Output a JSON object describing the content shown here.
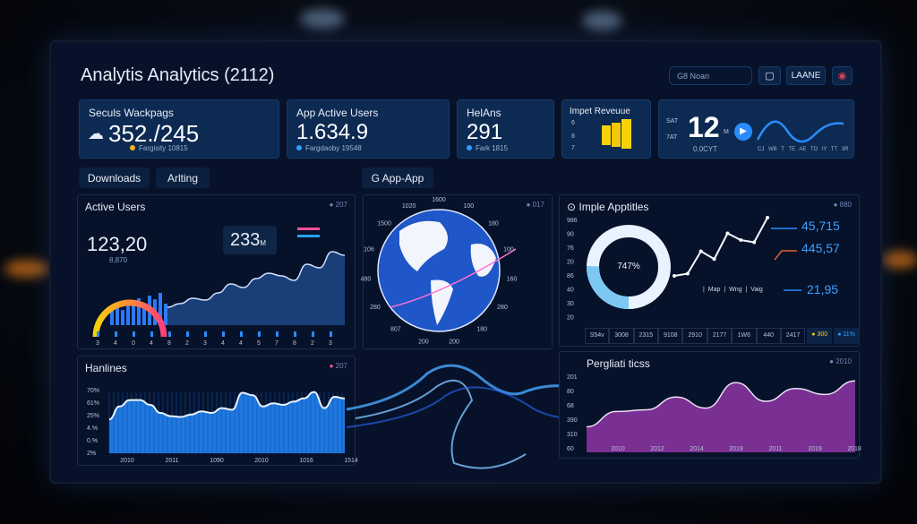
{
  "header": {
    "title": "Analytis Analytics (2112)",
    "search_placeholder": "G8 Noan",
    "button_label": "LAANE",
    "icons": [
      "clipboard-icon",
      "alert-icon"
    ]
  },
  "kpis": [
    {
      "label": "Seculs Wackpags",
      "value": "352./245",
      "sub": "Fargisity 10815",
      "dot": "#f2b51e",
      "icon": "cloud-icon"
    },
    {
      "label": "App Active Users",
      "value": "1.634.9",
      "sub": "Fargdaoby 19548",
      "dot": "#2aa0ff"
    },
    {
      "label": "HelAns",
      "value": "291",
      "sub": "Fark 1815",
      "dot": "#2aa0ff"
    },
    {
      "label": "Impet Reveuue",
      "ticks": [
        "6",
        "8",
        "7"
      ],
      "bar_color": "#f5d20a"
    },
    {
      "label_top": "SAT",
      "label_bottom": "7AT",
      "value": "12",
      "unit": "M",
      "sub": "0.0CYT",
      "days": [
        "CJ",
        "WB",
        "T",
        "TE",
        "AE",
        "TO",
        "IY",
        "TT",
        "3R"
      ]
    }
  ],
  "tabs": [
    "Downloads",
    "Arlting",
    "G App-App"
  ],
  "active_users": {
    "title": "Active Users",
    "legend": "207",
    "value": "123,20",
    "sub": "8,870",
    "callout": "233",
    "callout_unit": "M",
    "x_ticks": [
      "3",
      "4",
      "0",
      "4",
      "8",
      "2",
      "3",
      "4",
      "4",
      "5",
      "7",
      "8",
      "2",
      "3"
    ],
    "area": [
      20,
      24,
      30,
      28,
      36,
      46,
      42,
      52,
      58,
      55,
      50,
      68,
      64,
      82,
      78
    ],
    "bars": [
      30,
      35,
      28,
      45,
      42,
      50,
      38,
      55,
      48,
      60,
      40
    ]
  },
  "globe": {
    "legend": "017",
    "ticks": [
      "1600",
      "100",
      "180",
      "100",
      "160",
      "280",
      "180",
      "200",
      "200",
      "807",
      "280",
      "480",
      "106",
      "1500",
      "1020"
    ]
  },
  "apptitles": {
    "title": "Imple Apptitles",
    "legend": "880",
    "y_ticks": [
      "986",
      "90",
      "76",
      "20",
      "86",
      "40",
      "30",
      "20"
    ],
    "donut_label": "747%",
    "donut_fraction": 0.747,
    "line": [
      40,
      42,
      62,
      55,
      78,
      72,
      70,
      92
    ],
    "values": [
      "45,715",
      "445,57",
      "21,95"
    ],
    "labels": [
      "Map",
      "Wng",
      "Vaig"
    ],
    "footer": [
      "S54v",
      "3008",
      "2315",
      "9108",
      "2910",
      "2177",
      "1W6",
      "440",
      "2417"
    ],
    "footer_badges": [
      "300",
      "11%"
    ]
  },
  "hanlines": {
    "title": "Hanlines",
    "legend": "207",
    "y_ticks": [
      "70%",
      "61%",
      "25%",
      "4.%",
      "0.%",
      "2%"
    ],
    "x_ticks": [
      "2010",
      "2011",
      "1090",
      "2010",
      "1016",
      "1514"
    ],
    "series": [
      42,
      58,
      66,
      66,
      60,
      50,
      46,
      45,
      48,
      52,
      50,
      56,
      54,
      75,
      72,
      58,
      62,
      60,
      64,
      68,
      76,
      56,
      70,
      68
    ]
  },
  "pergliati": {
    "title": "Pergliati ticss",
    "legend": "2010",
    "y_ticks": [
      "201",
      "80",
      "68",
      "390",
      "310",
      "60"
    ],
    "x_ticks": [
      "2010",
      "2012",
      "2014",
      "2019",
      "2011",
      "2019",
      "2018"
    ],
    "series": [
      30,
      48,
      50,
      65,
      52,
      82,
      60,
      75,
      68,
      84
    ]
  },
  "colors": {
    "accent": "#2a8cff",
    "purple": "#8a3aa0",
    "yellow": "#f5d20a",
    "pink": "#ff4f9a"
  }
}
